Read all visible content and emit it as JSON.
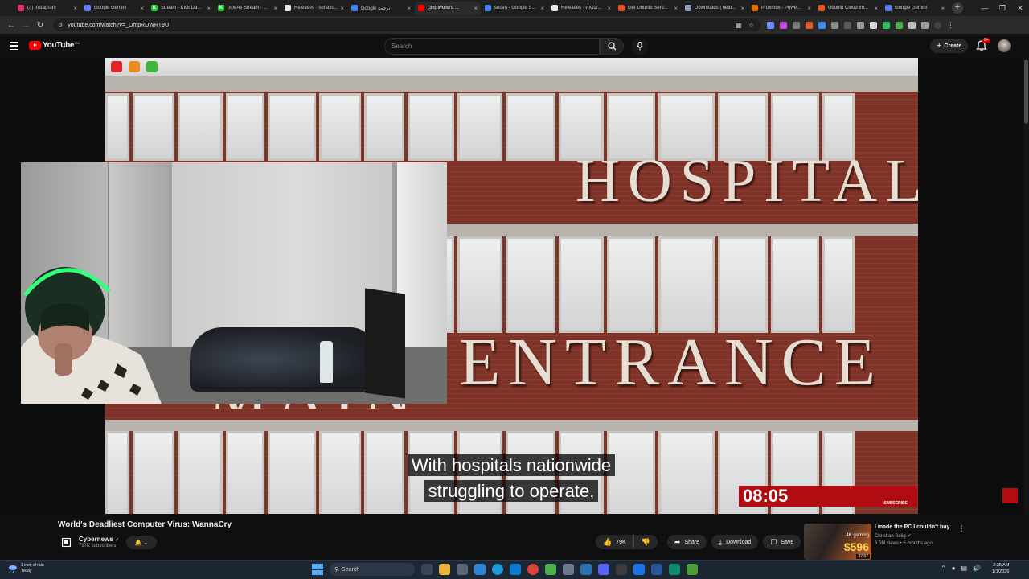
{
  "browser": {
    "tabs": [
      {
        "title": "(3) Instagram",
        "color": "#e1306c",
        "glyph": ""
      },
      {
        "title": "Google Gemini",
        "color": "#5f7fff",
        "glyph": ""
      },
      {
        "title": "Stream - Kick Da...",
        "color": "#1fc62c",
        "glyph": "K"
      },
      {
        "title": "pipeAs Stream - ...",
        "color": "#1fc62c",
        "glyph": "K"
      },
      {
        "title": "Releases · sonayu...",
        "color": "#e8e8e8",
        "glyph": ""
      },
      {
        "title": "Google ترجمة",
        "color": "#4285f4",
        "glyph": ""
      },
      {
        "title": "(36) World's ...",
        "color": "#ff0000",
        "glyph": "",
        "active": true
      },
      {
        "title": "seova - Google S...",
        "color": "#4285f4",
        "glyph": ""
      },
      {
        "title": "Releases · PIO2/...",
        "color": "#e8e8e8",
        "glyph": ""
      },
      {
        "title": "Get Ubuntu Serv...",
        "color": "#e95420",
        "glyph": ""
      },
      {
        "title": "Downloads | netb...",
        "color": "#8fa0b8",
        "glyph": ""
      },
      {
        "title": "Proxmox - Powe...",
        "color": "#e57000",
        "glyph": ""
      },
      {
        "title": "Ubuntu Cloud Im...",
        "color": "#e95420",
        "glyph": ""
      },
      {
        "title": "Google Gemini",
        "color": "#5f7fff",
        "glyph": ""
      }
    ],
    "url": "youtube.com/watch?v=_OmpRDWRT9U"
  },
  "youtube": {
    "logo_text": "YouTube",
    "country_code": "MA",
    "search_placeholder": "Search",
    "create_label": "Create",
    "notifications_badge": "9+"
  },
  "video": {
    "sign_line1": "HOSPITAL",
    "sign_line2": "ENTRANCE",
    "sign_line2_partial": "MAIN",
    "subtitle_line1": "With hospitals nationwide",
    "subtitle_line2": "struggling to operate,",
    "timestamp": "08:05",
    "timestamp_tag": "SUBSCRIBE"
  },
  "details": {
    "title": "World's Deadliest Computer Virus: WannaCry",
    "channel": "Cybernews",
    "subscribers": "797K subscribers",
    "likes": "79K",
    "share_label": "Share",
    "download_label": "Download",
    "save_label": "Save"
  },
  "recommendation": {
    "title": "I made the PC I couldn't buy",
    "channel": "Christian Selig",
    "meta": "6.5M views • 6 months ago",
    "thumb_tag": "4K gaming",
    "thumb_price": "$596",
    "duration": "37:57"
  },
  "taskbar": {
    "weather_line1": "1 inch of rain",
    "weather_line2": "Today",
    "search_label": "Search",
    "time": "2:35 AM",
    "date": "1/1/2026"
  }
}
